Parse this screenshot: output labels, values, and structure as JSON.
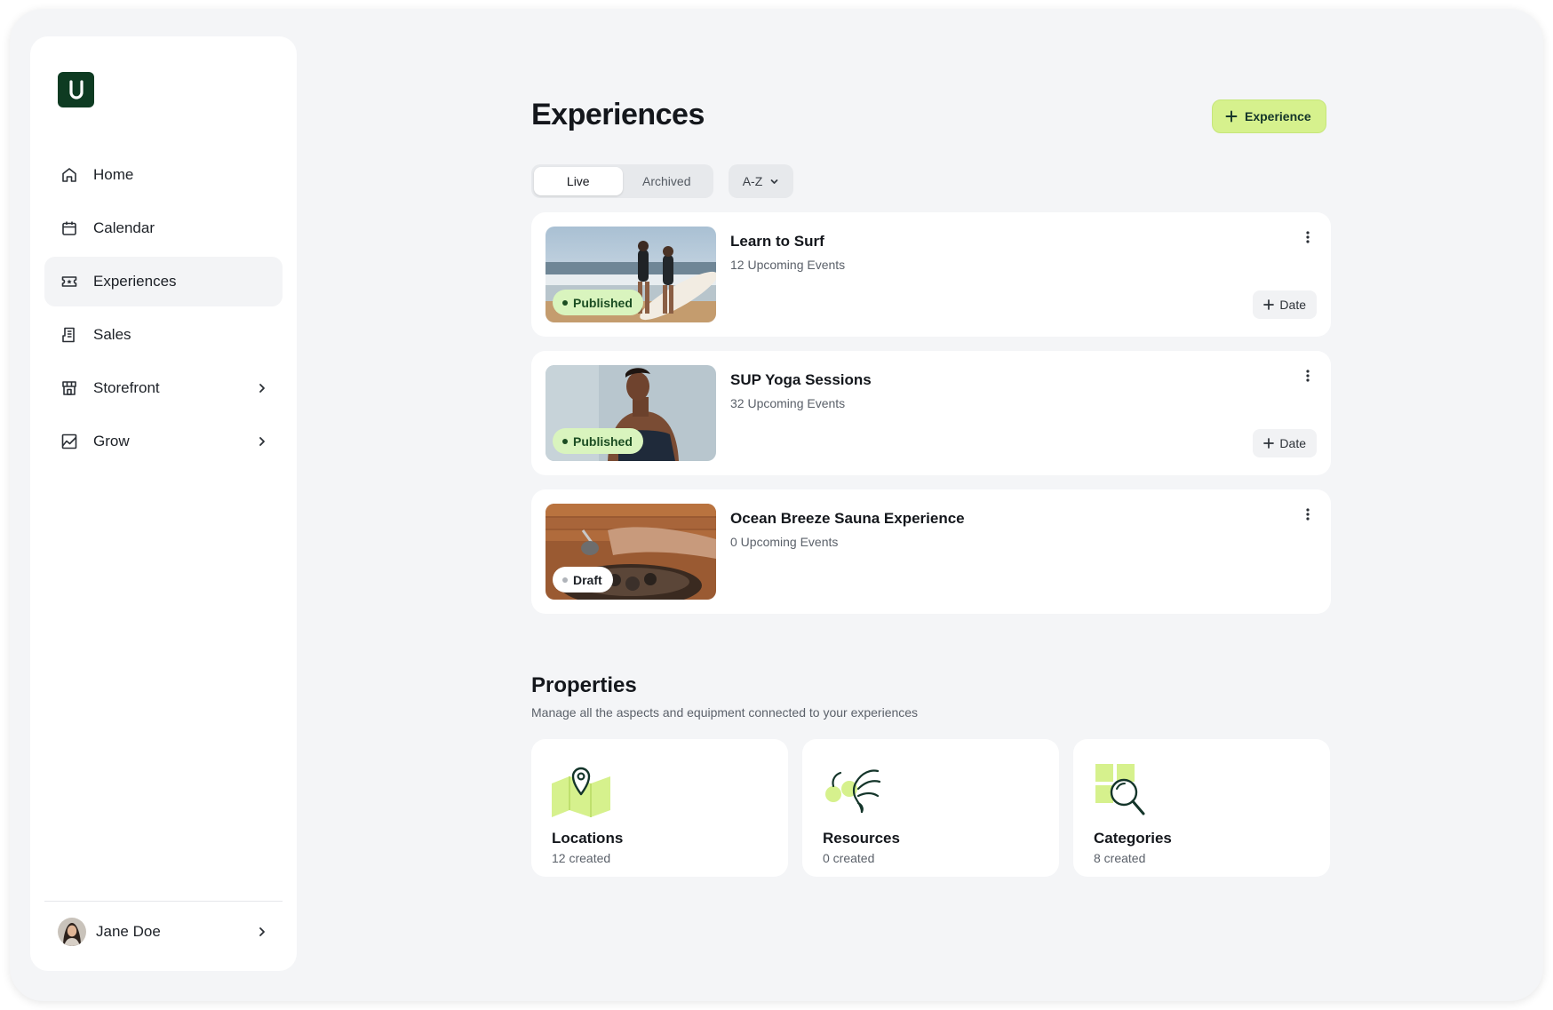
{
  "brand": {
    "logo_letter": "U",
    "logo_color": "#0e3b22",
    "accent": "#d6f18d"
  },
  "sidebar": {
    "items": [
      {
        "label": "Home",
        "icon": "home-icon"
      },
      {
        "label": "Calendar",
        "icon": "calendar-icon"
      },
      {
        "label": "Experiences",
        "icon": "ticket-icon",
        "active": true
      },
      {
        "label": "Sales",
        "icon": "receipt-icon"
      },
      {
        "label": "Storefront",
        "icon": "storefront-icon",
        "has_submenu": true
      },
      {
        "label": "Grow",
        "icon": "chart-icon",
        "has_submenu": true
      }
    ],
    "user": {
      "name": "Jane Doe"
    }
  },
  "header": {
    "title": "Experiences",
    "add_button_label": "Experience"
  },
  "filters": {
    "tabs": [
      {
        "label": "Live",
        "active": true
      },
      {
        "label": "Archived"
      }
    ],
    "sort_label": "A-Z"
  },
  "experiences": [
    {
      "title": "Learn to Surf",
      "subtitle": "12 Upcoming Events",
      "status": "Published",
      "date_button": "Date"
    },
    {
      "title": "SUP Yoga Sessions",
      "subtitle": "32 Upcoming Events",
      "status": "Published",
      "date_button": "Date"
    },
    {
      "title": "Ocean Breeze Sauna Experience",
      "subtitle": "0 Upcoming Events",
      "status": "Draft"
    }
  ],
  "properties": {
    "title": "Properties",
    "subtitle": "Manage all the aspects and equipment connected to your experiences",
    "cards": [
      {
        "name": "Locations",
        "count": "12 created",
        "icon": "map-pin-icon"
      },
      {
        "name": "Resources",
        "count": "0 created",
        "icon": "resources-icon"
      },
      {
        "name": "Categories",
        "count": "8 created",
        "icon": "magnifier-icon"
      }
    ]
  }
}
